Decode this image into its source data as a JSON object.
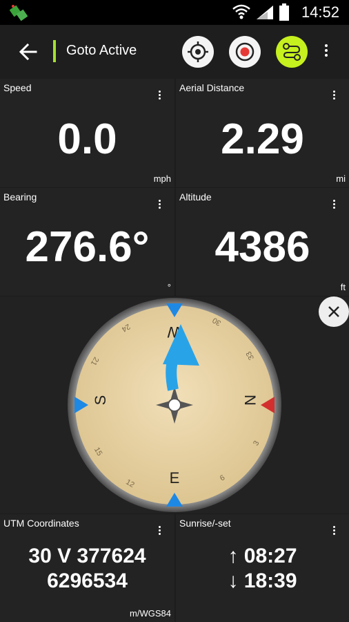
{
  "status_bar": {
    "time": "14:52",
    "icons": [
      "app-notification-icon",
      "wifi-icon",
      "signal-icon",
      "battery-icon"
    ]
  },
  "app_bar": {
    "title": "Goto Active",
    "accent_color": "#a6e22e",
    "actions": [
      "locate-icon",
      "record-icon",
      "route-icon",
      "overflow-menu-icon"
    ]
  },
  "tiles": {
    "speed": {
      "label": "Speed",
      "value": "0.0",
      "unit": "mph"
    },
    "aerial_distance": {
      "label": "Aerial Distance",
      "value": "2.29",
      "unit": "mi"
    },
    "bearing": {
      "label": "Bearing",
      "value": "276.6°",
      "unit": "°"
    },
    "altitude": {
      "label": "Altitude",
      "value": "4386",
      "unit": "ft"
    },
    "utm": {
      "label": "UTM Coordinates",
      "line1": "30 V 377624",
      "line2": "6296534",
      "unit": "m/WGS84"
    },
    "sun": {
      "label": "Sunrise/-set",
      "line1": "↑ 08:27",
      "line2": "↓ 18:39"
    }
  },
  "compass": {
    "cardinals": {
      "N": "N",
      "E": "E",
      "S": "S",
      "W": "W"
    },
    "degree_labels": [
      "30",
      "33",
      "3",
      "6",
      "12",
      "15",
      "21",
      "24"
    ],
    "face_color": "#e8d3a3",
    "north_color": "#d32f2f",
    "marker_color": "#1e88e5",
    "arrow_color": "#29a3e8"
  }
}
